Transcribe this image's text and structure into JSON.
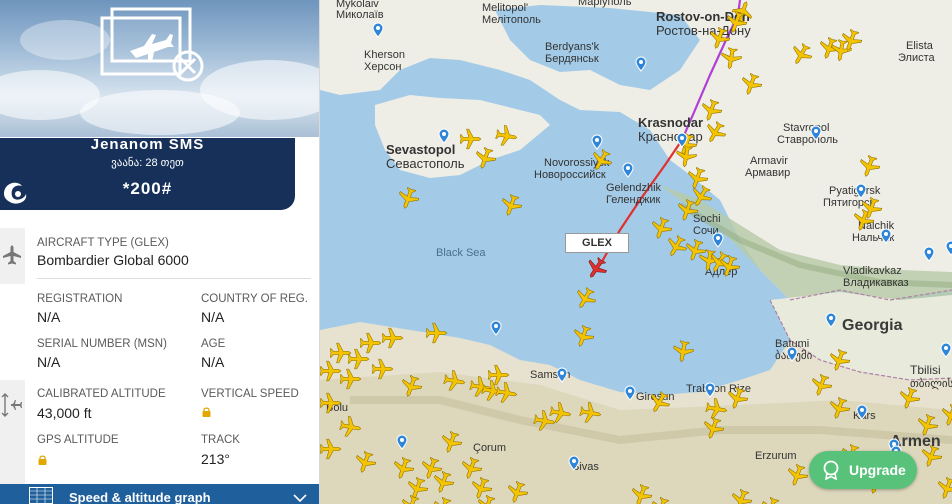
{
  "banner": {
    "title": "Jenanom SMS",
    "subtitle": "ვაანა: 28 თეთ",
    "code": "*200#"
  },
  "aircraft": {
    "type_label": "AIRCRAFT TYPE",
    "type_code": "(GLEX)",
    "type_value": "Bombardier Global 6000",
    "registration_label": "REGISTRATION",
    "registration_value": "N/A",
    "country_label": "COUNTRY OF REG.",
    "country_value": "N/A",
    "serial_label": "SERIAL NUMBER (MSN)",
    "serial_value": "N/A",
    "age_label": "AGE",
    "age_value": "N/A",
    "cal_alt_label": "CALIBRATED ALTITUDE",
    "cal_alt_value": "43,000 ft",
    "vert_speed_label": "VERTICAL SPEED",
    "gps_alt_label": "GPS ALTITUDE",
    "track_label": "TRACK",
    "track_value": "213°"
  },
  "bottom_bar": {
    "label": "Speed & altitude graph"
  },
  "map": {
    "selected_flight": "GLEX",
    "upgrade_label": "Upgrade",
    "labels": {
      "mykolaiv_en": "Mykolaiv",
      "mykolaiv_uk": "Миколаїв",
      "melitopol_en": "Melitopol'",
      "melitopol_ru": "Мелітополь",
      "mariupol": "Маріуполь",
      "rostov_en": "Rostov-on-Don",
      "rostov_ru": "Ростов-на-Дону",
      "kherson_en": "Kherson",
      "kherson_uk": "Херсон",
      "berdyansk_en": "Berdyans'k",
      "berdyansk_uk": "Бердянськ",
      "krasnodar_en": "Krasnodar",
      "krasnodar_ru": "Краснодар",
      "stavropol_en": "Stavropol",
      "stavropol_ru": "Ставрополь",
      "sevastopol_en": "Sevastopol",
      "sevastopol_ru": "Севастополь",
      "novorossiysk_en": "Novorossiysk",
      "novorossiysk_ru": "Новороссийск",
      "armavir_en": "Armavir",
      "armavir_ru": "Армавир",
      "gelendzhik_en": "Gelendzhik",
      "gelendzhik_ru": "Геленджик",
      "pyatigorsk_en": "Pyatigorsk",
      "pyatigorsk_ru": "Пятигорск",
      "sochi_en": "Sochi",
      "sochi_ru": "Сочи",
      "nalchik_en": "Nalchik",
      "nalchik_ru": "Нальчик",
      "adler": "Адлер",
      "vladikavkaz_en": "Vladikavkaz",
      "vladikavkaz_ru": "Владикавказ",
      "black_sea": "Black Sea",
      "georgia": "Georgia",
      "batumi_en": "Batumi",
      "batumi_ka": "ბათუმი",
      "tbilisi_en": "Tbilisi",
      "tbilisi_ka": "თბილისი",
      "samsun": "Samsun",
      "giresun": "Giresun",
      "trabzon_rize": "Trabzon Rize",
      "bolu": "Bolu",
      "corum": "Çorum",
      "kars": "Kars",
      "sivas": "Sivas",
      "erzurum": "Erzurum",
      "armenia": "Armen",
      "elista": "Elista",
      "elista_ru": "Элиста"
    }
  },
  "colors": {
    "banner": "#16305a",
    "plane": "#f5c400",
    "route_past": "#b13ed6",
    "route_recent": "#e03030",
    "upgrade": "#59c27a",
    "bar": "#1f5f9c"
  }
}
